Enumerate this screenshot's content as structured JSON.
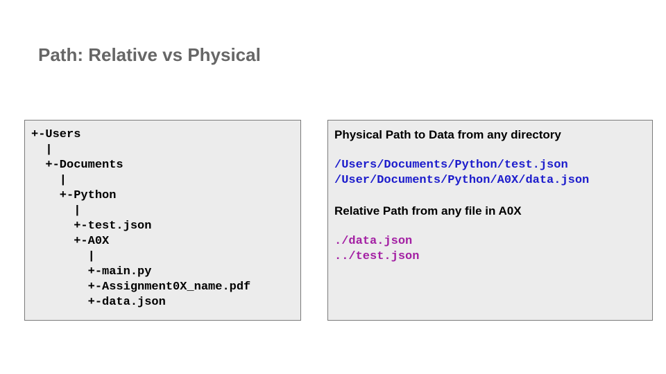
{
  "title": "Path: Relative vs Physical",
  "tree": {
    "lines": [
      "+-Users",
      "  |",
      "  +-Documents",
      "    |",
      "    +-Python",
      "      |",
      "      +-test.json",
      "      +-A0X",
      "        |",
      "        +-main.py",
      "        +-Assignment0X_name.pdf",
      "        +-data.json"
    ]
  },
  "physical": {
    "heading": "Physical Path to Data from any directory",
    "paths": [
      "/Users/Documents/Python/test.json",
      "/User/Documents/Python/A0X/data.json"
    ],
    "color": "#1c1ccc"
  },
  "relative": {
    "heading": "Relative Path from any file in A0X",
    "paths": [
      "./data.json",
      "../test.json"
    ],
    "color": "#a31fa3"
  }
}
